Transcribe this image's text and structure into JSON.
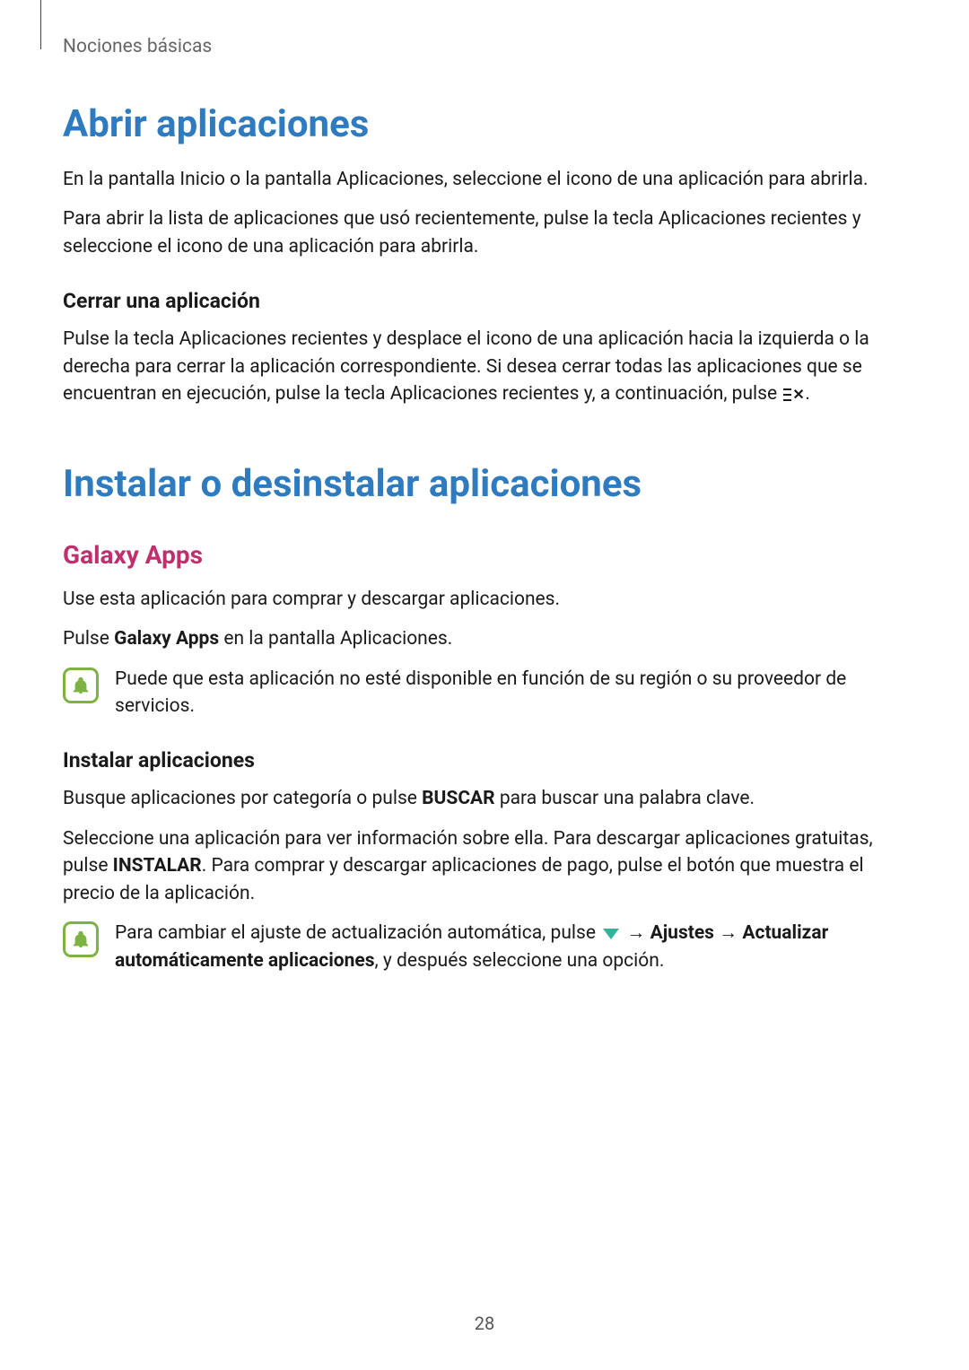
{
  "breadcrumb": "Nociones básicas",
  "section1": {
    "title": "Abrir aplicaciones",
    "para1": "En la pantalla Inicio o la pantalla Aplicaciones, seleccione el icono de una aplicación para abrirla.",
    "para2": "Para abrir la lista de aplicaciones que usó recientemente, pulse la tecla Aplicaciones recientes y seleccione el icono de una aplicación para abrirla.",
    "sub1_title": "Cerrar una aplicación",
    "sub1_para_pre": "Pulse la tecla Aplicaciones recientes y desplace el icono de una aplicación hacia la izquierda o la derecha para cerrar la aplicación correspondiente. Si desea cerrar todas las aplicaciones que se encuentran en ejecución, pulse la tecla Aplicaciones recientes y, a continuación, pulse ",
    "sub1_para_post": "."
  },
  "section2": {
    "title": "Instalar o desinstalar aplicaciones",
    "sub1_title": "Galaxy Apps",
    "sub1_para1": "Use esta aplicación para comprar y descargar aplicaciones.",
    "sub1_para2_pre": "Pulse ",
    "sub1_para2_bold": "Galaxy Apps",
    "sub1_para2_post": " en la pantalla Aplicaciones.",
    "note1": "Puede que esta aplicación no esté disponible en función de su región o su proveedor de servicios.",
    "sub2_title": "Instalar aplicaciones",
    "sub2_para1_pre": "Busque aplicaciones por categoría o pulse ",
    "sub2_para1_bold": "BUSCAR",
    "sub2_para1_post": " para buscar una palabra clave.",
    "sub2_para2_pre": "Seleccione una aplicación para ver información sobre ella. Para descargar aplicaciones gratuitas, pulse ",
    "sub2_para2_bold": "INSTALAR",
    "sub2_para2_post": ". Para comprar y descargar aplicaciones de pago, pulse el botón que muestra el precio de la aplicación.",
    "note2_pre": "Para cambiar el ajuste de actualización automática, pulse ",
    "note2_arrow1": " → ",
    "note2_bold1": "Ajustes",
    "note2_arrow2": " → ",
    "note2_bold2": "Actualizar automáticamente aplicaciones",
    "note2_post": ", y después seleccione una opción."
  },
  "page_number": "28"
}
